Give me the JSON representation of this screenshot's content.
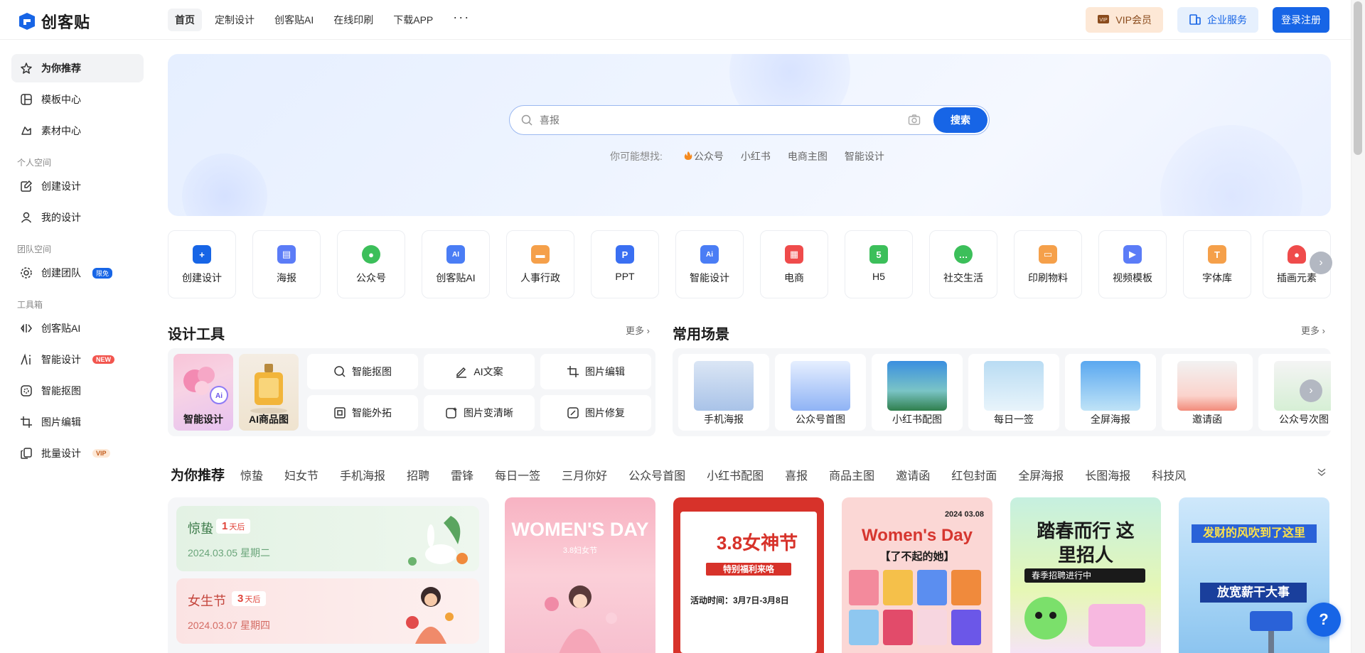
{
  "brand": {
    "name": "创客贴"
  },
  "nav": {
    "items": [
      {
        "label": "首页",
        "active": true
      },
      {
        "label": "定制设计"
      },
      {
        "label": "创客贴AI"
      },
      {
        "label": "在线印刷"
      },
      {
        "label": "下载APP"
      }
    ],
    "more": "···"
  },
  "top_right": {
    "vip": "VIP会员",
    "enterprise": "企业服务",
    "login": "登录注册"
  },
  "sidebar": {
    "main": [
      {
        "label": "为你推荐",
        "active": true
      },
      {
        "label": "模板中心"
      },
      {
        "label": "素材中心"
      }
    ],
    "personal_title": "个人空间",
    "personal": [
      {
        "label": "创建设计"
      },
      {
        "label": "我的设计"
      }
    ],
    "team_title": "团队空间",
    "team": [
      {
        "label": "创建团队",
        "badge": "限免"
      }
    ],
    "tools_title": "工具箱",
    "tools": [
      {
        "label": "创客贴AI"
      },
      {
        "label": "智能设计",
        "badge": "NEW"
      },
      {
        "label": "智能抠图"
      },
      {
        "label": "图片编辑"
      },
      {
        "label": "批量设计",
        "badge": "VIP"
      }
    ]
  },
  "search": {
    "placeholder": "喜报",
    "button": "搜索",
    "suggest_label": "你可能想找:",
    "suggestions": [
      "公众号",
      "小红书",
      "电商主图",
      "智能设计"
    ]
  },
  "categories": [
    {
      "label": "创建设计",
      "color": "#1765e6"
    },
    {
      "label": "海报",
      "color": "#5b7cf7"
    },
    {
      "label": "公众号",
      "color": "#3cbf5a"
    },
    {
      "label": "创客贴AI",
      "color": "#4a7df5"
    },
    {
      "label": "人事行政",
      "color": "#f5a04a"
    },
    {
      "label": "PPT",
      "color": "#3a6ff2"
    },
    {
      "label": "智能设计",
      "color": "#4a7df5"
    },
    {
      "label": "电商",
      "color": "#ef4b4b"
    },
    {
      "label": "H5",
      "color": "#3cbf5a"
    },
    {
      "label": "社交生活",
      "color": "#3cbf5a"
    },
    {
      "label": "印刷物料",
      "color": "#f5a04a"
    },
    {
      "label": "视频模板",
      "color": "#5b7cf7"
    },
    {
      "label": "字体库",
      "color": "#f5a04a"
    },
    {
      "label": "插画元素",
      "color": "#ef4b4b"
    }
  ],
  "design_tools": {
    "title": "设计工具",
    "more": "更多",
    "images": [
      {
        "label": "智能设计"
      },
      {
        "label": "AI商品图"
      }
    ],
    "buttons": [
      {
        "label": "智能抠图"
      },
      {
        "label": "AI文案"
      },
      {
        "label": "图片编辑"
      },
      {
        "label": "智能外拓"
      },
      {
        "label": "图片变清晰"
      },
      {
        "label": "图片修复"
      }
    ]
  },
  "scenes": {
    "title": "常用场景",
    "more": "更多",
    "items": [
      {
        "label": "手机海报"
      },
      {
        "label": "公众号首图"
      },
      {
        "label": "小红书配图"
      },
      {
        "label": "每日一签"
      },
      {
        "label": "全屏海报"
      },
      {
        "label": "邀请函"
      },
      {
        "label": "公众号次图"
      }
    ]
  },
  "recommend": {
    "title": "为你推荐",
    "tabs": [
      "惊蛰",
      "妇女节",
      "手机海报",
      "招聘",
      "雷锋",
      "每日一签",
      "三月你好",
      "公众号首图",
      "小红书配图",
      "喜报",
      "商品主图",
      "邀请函",
      "红包封面",
      "全屏海报",
      "长图海报",
      "科技风"
    ]
  },
  "festivals": [
    {
      "name": "惊蛰",
      "days": "1",
      "days_unit": "天后",
      "date": "2024.03.05 星期二"
    },
    {
      "name": "女生节",
      "days": "3",
      "days_unit": "天后",
      "date": "2024.03.07 星期四"
    }
  ],
  "posters": [
    {
      "title": "WOMEN'S DAY",
      "sub": "3.8妇女节"
    },
    {
      "title": "3.8女神节",
      "sub": "特别福利来咯",
      "line": "活动时间：3月7日-3月8日"
    },
    {
      "title": "Women's Day",
      "sub": "【了不起的她】",
      "date": "2024 03.08"
    },
    {
      "title": "踏春而行 这里招人",
      "sub": "春季招聘进行中"
    },
    {
      "title": "发财的风吹到了这里",
      "sub": "放宽薪干大事"
    }
  ],
  "help": "?"
}
